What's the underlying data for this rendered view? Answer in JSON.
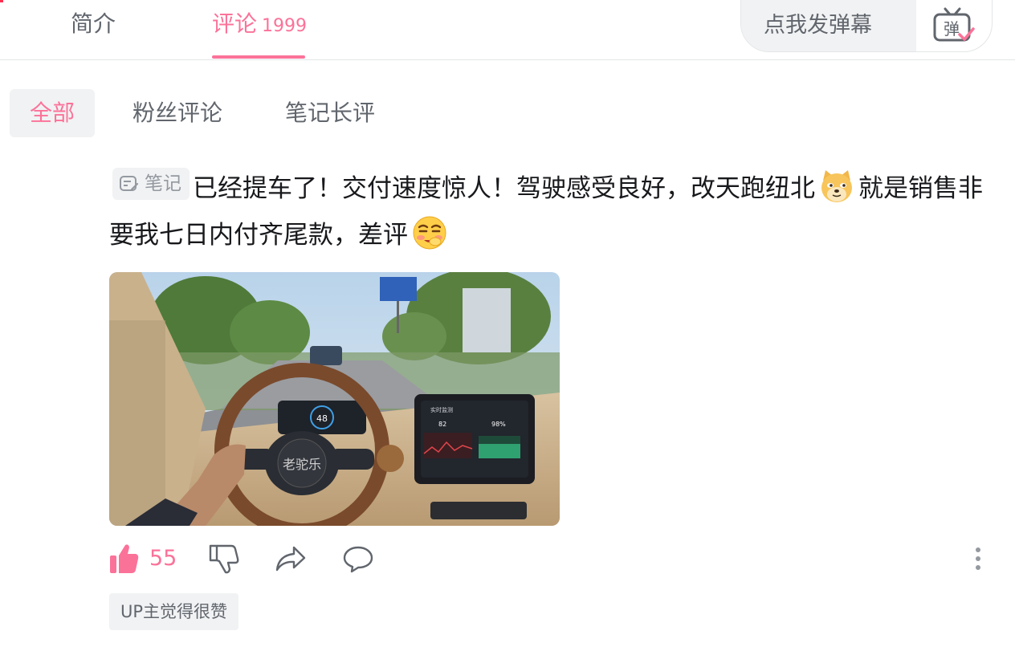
{
  "tabs": {
    "intro_label": "简介",
    "comments_label": "评论",
    "comments_count": "1999"
  },
  "danmaku": {
    "placeholder": "点我发弹幕",
    "toggle_label": "弹"
  },
  "filters": {
    "all": "全部",
    "fans": "粉丝评论",
    "notes": "笔记长评"
  },
  "comment": {
    "note_badge": "笔记",
    "text_part1": "已经提车了！交付速度惊人！驾驶感受良好，改天跑纽北",
    "text_part2": "就是销售非要我七日内付齐尾款，差评",
    "emoji1": "doge-emoji",
    "emoji2": "smirk-blush-emoji",
    "photo_steering_text": "老驼乐",
    "photo_speed": "48",
    "photo_screen_title": "实时监测",
    "photo_hr_value": "82",
    "photo_spo2_value": "98%",
    "like_count": "55",
    "up_badge": "UP主觉得很赞"
  },
  "colors": {
    "accent": "#fb7299",
    "text_primary": "#18191c",
    "text_secondary": "#61666d",
    "bg_chip": "#f1f2f3"
  }
}
